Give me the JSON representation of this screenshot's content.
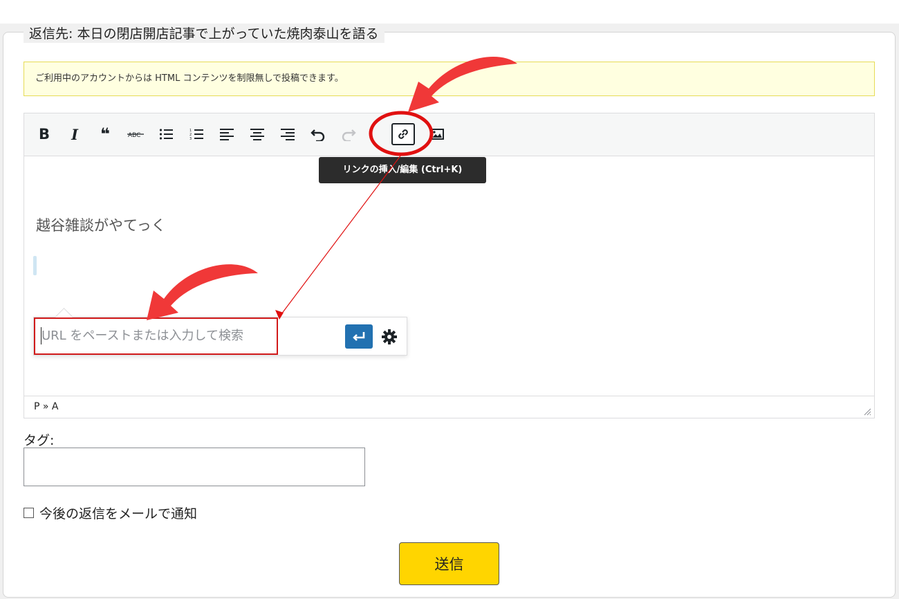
{
  "reply_form": {
    "legend": "返信先: 本日の閉店開店記事で上がっていた焼肉泰山を語る",
    "notice": "ご利用中のアカウントからは HTML コンテンツを制限無しで投稿できます。"
  },
  "editor": {
    "toolbar": [
      {
        "icon": "bold-icon",
        "glyph": "B"
      },
      {
        "icon": "italic-icon",
        "glyph": "I"
      },
      {
        "icon": "blockquote-icon",
        "glyph": "❝"
      },
      {
        "icon": "strikethrough-icon",
        "glyph": "ABC"
      },
      {
        "icon": "bulleted-list-icon",
        "glyph": "☰"
      },
      {
        "icon": "numbered-list-icon",
        "glyph": "☰"
      },
      {
        "icon": "align-left-icon",
        "glyph": "≡"
      },
      {
        "icon": "align-center-icon",
        "glyph": "≡"
      },
      {
        "icon": "align-right-icon",
        "glyph": "≡"
      },
      {
        "icon": "undo-icon",
        "glyph": "↶"
      },
      {
        "icon": "redo-icon",
        "glyph": "↷"
      },
      {
        "icon": "link-icon",
        "glyph": "🔗"
      },
      {
        "icon": "image-icon",
        "glyph": "▣"
      }
    ],
    "tooltip": "リンクの挿入/編集 (Ctrl+K)",
    "content_text": "越谷雑談がやてっく",
    "link_popup": {
      "placeholder": "URL をペーストまたは入力して検索",
      "apply_icon": "enter-icon",
      "settings_icon": "gear-icon"
    },
    "status_path": "P » A"
  },
  "tags": {
    "label": "タグ:",
    "value": ""
  },
  "notify": {
    "label": "今後の返信をメールで通知",
    "checked": false
  },
  "submit": {
    "label": "送信",
    "color": "#ffd500"
  },
  "annotations": {
    "arrow_color": "#f03838",
    "highlight_color": "#e01010"
  }
}
